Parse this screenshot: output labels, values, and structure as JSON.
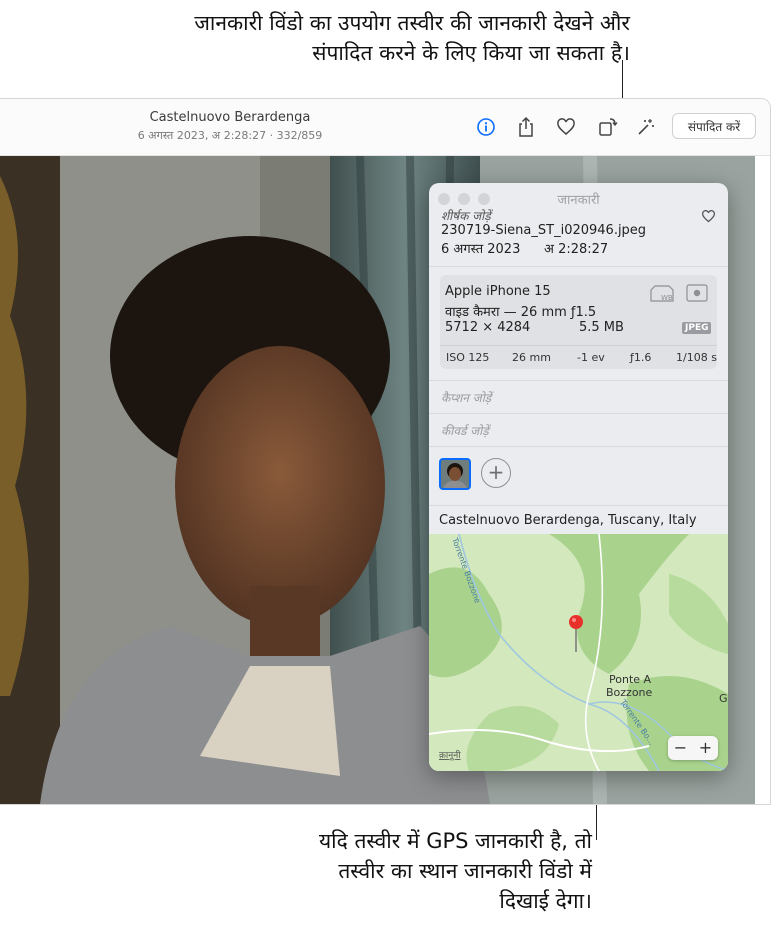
{
  "callouts": {
    "top_line1": "जानकारी विंडो का उपयोग तस्वीर की जानकारी देखने और",
    "top_line2": "संपादित करने के लिए किया जा सकता है।",
    "bottom_line1": "यदि तस्वीर में GPS जानकारी है, तो",
    "bottom_line2": "तस्वीर का स्थान जानकारी विंडो में",
    "bottom_line3": "दिखाई देगा।"
  },
  "toolbar": {
    "title": "Castelnuovo Berardenga",
    "meta": "6 अगस्त 2023, अ 2:28:27  ·  332/859",
    "edit_label": "संपादित करें",
    "icons": [
      "info-icon",
      "share-icon",
      "heart-icon",
      "rotate-icon",
      "magic-wand-icon"
    ]
  },
  "info_panel": {
    "title": "जानकारी",
    "add_title": "शीर्षक जोड़ें",
    "filename": "230719-Siena_ST_i020946.jpeg",
    "date": "6 अगस्त 2023",
    "time": "अ 2:28:27",
    "camera": {
      "model": "Apple iPhone 15",
      "lens": "वाइड कैमरा — 26 mm ƒ1.5",
      "resolution": "5712 × 4284",
      "size": "5.5 MB",
      "format": "JPEG",
      "iso": "ISO 125",
      "focal": "26 mm",
      "ev": "-1 ev",
      "aperture": "ƒ1.6",
      "shutter": "1/108 s"
    },
    "add_caption": "कैप्शन जोड़ें",
    "add_keywords": "कीवर्ड जोड़ें",
    "add_person_symbol": "+",
    "location": "Castelnuovo Berardenga, Tuscany, Italy"
  },
  "map": {
    "place_line1": "Ponte A",
    "place_line2": "Bozzone",
    "river1": "Torrente Bozzone",
    "river2": "Torrente Bo...",
    "edge_letter": "G",
    "legal": "क़ानूनी",
    "zoom_out": "−",
    "zoom_in": "+"
  },
  "colors": {
    "accent": "#0a6cff",
    "pin": "#e8312b",
    "map_green": "#cfe6b8"
  }
}
